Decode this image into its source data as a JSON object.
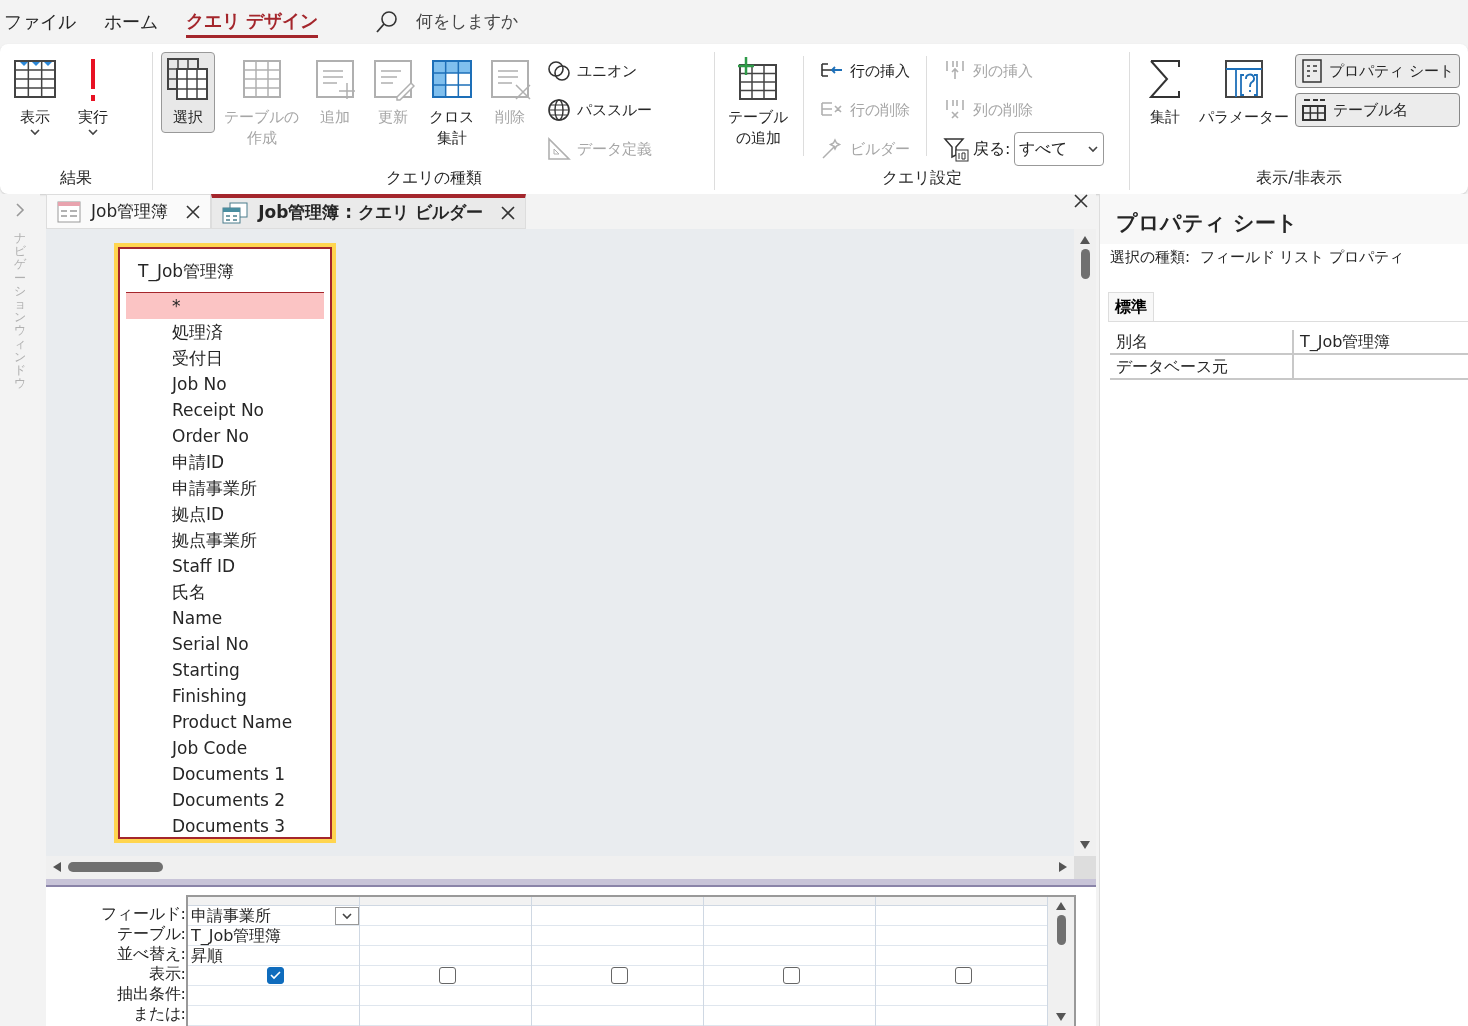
{
  "menu_tabs": [
    {
      "label": "ファイル",
      "selected": false
    },
    {
      "label": "ホーム",
      "selected": false
    },
    {
      "label": "クエリ デザイン",
      "selected": true
    }
  ],
  "tell_me": {
    "placeholder": "何をしますか"
  },
  "ribbon_groups": [
    {
      "label": "結果",
      "buttons": [
        {
          "kind": "large",
          "label": "表示",
          "dropdown": true,
          "disabled": false,
          "selected": false
        },
        {
          "kind": "large",
          "label": "実行",
          "dropdown": true,
          "disabled": false,
          "selected": false
        }
      ]
    },
    {
      "label": "クエリの種類",
      "buttons": [
        {
          "kind": "large",
          "label": "選択",
          "dropdown": false,
          "disabled": false,
          "selected": true
        },
        {
          "kind": "large",
          "label": "テーブルの作成",
          "dropdown": false,
          "disabled": true,
          "selected": false
        },
        {
          "kind": "large",
          "label": "追加",
          "dropdown": false,
          "disabled": true,
          "selected": false
        },
        {
          "kind": "large",
          "label": "更新",
          "dropdown": false,
          "disabled": true,
          "selected": false
        },
        {
          "kind": "large",
          "label": "クロス集計",
          "dropdown": false,
          "disabled": false,
          "selected": false
        },
        {
          "kind": "large",
          "label": "削除",
          "dropdown": false,
          "disabled": true,
          "selected": false
        },
        {
          "kind": "small",
          "label": "ユニオン",
          "disabled": false,
          "selected": false
        },
        {
          "kind": "small",
          "label": "パススルー",
          "disabled": false,
          "selected": false
        },
        {
          "kind": "small",
          "label": "データ定義",
          "disabled": true,
          "selected": false
        }
      ]
    },
    {
      "label": "クエリ設定",
      "buttons": [
        {
          "kind": "large",
          "label": "テーブルの追加",
          "dropdown": false,
          "disabled": false,
          "selected": false
        },
        {
          "kind": "separator"
        },
        {
          "kind": "small",
          "label": "行の挿入",
          "disabled": false,
          "selected": false
        },
        {
          "kind": "small",
          "label": "行の削除",
          "disabled": true,
          "selected": false
        },
        {
          "kind": "small",
          "label": "ビルダー",
          "disabled": true,
          "selected": false
        },
        {
          "kind": "separator"
        },
        {
          "kind": "small",
          "label": "列の挿入",
          "disabled": true,
          "selected": false
        },
        {
          "kind": "small",
          "label": "列の削除",
          "disabled": true,
          "selected": false
        },
        {
          "kind": "combo",
          "label": "戻る:",
          "value": "すべて",
          "dropdown": true
        }
      ]
    },
    {
      "label": "表示/非表示",
      "buttons": [
        {
          "kind": "large",
          "label": "集計",
          "dropdown": false,
          "disabled": false,
          "selected": false
        },
        {
          "kind": "large",
          "label": "パラメーター",
          "dropdown": false,
          "disabled": false,
          "selected": false
        },
        {
          "kind": "small",
          "label": "プロパティ シート",
          "disabled": false,
          "selected": true
        },
        {
          "kind": "small",
          "label": "テーブル名",
          "disabled": false,
          "selected": true
        }
      ]
    }
  ],
  "nav_pane": {
    "title": "ナビゲーションウィンドウ"
  },
  "doc_tabs": [
    {
      "label": "Job管理簿",
      "selected": false
    },
    {
      "label": "Job管理簿 : クエリ ビルダー",
      "selected": true
    }
  ],
  "field_list": {
    "title": "T_Job管理簿",
    "fields": [
      {
        "name": "*",
        "selected": true
      },
      {
        "name": "処理済",
        "selected": false
      },
      {
        "name": "受付日",
        "selected": false
      },
      {
        "name": "Job No",
        "selected": false
      },
      {
        "name": "Receipt No",
        "selected": false
      },
      {
        "name": "Order No",
        "selected": false
      },
      {
        "name": "申請ID",
        "selected": false
      },
      {
        "name": "申請事業所",
        "selected": false
      },
      {
        "name": "拠点ID",
        "selected": false
      },
      {
        "name": "拠点事業所",
        "selected": false
      },
      {
        "name": "Staff ID",
        "selected": false
      },
      {
        "name": "氏名",
        "selected": false
      },
      {
        "name": "Name",
        "selected": false
      },
      {
        "name": "Serial No",
        "selected": false
      },
      {
        "name": "Starting",
        "selected": false
      },
      {
        "name": "Finishing",
        "selected": false
      },
      {
        "name": "Product Name",
        "selected": false
      },
      {
        "name": "Job Code",
        "selected": false
      },
      {
        "name": "Documents 1",
        "selected": false
      },
      {
        "name": "Documents 2",
        "selected": false
      },
      {
        "name": "Documents 3",
        "selected": false
      }
    ]
  },
  "grid": {
    "row_labels": [
      "フィールド:",
      "テーブル:",
      "並べ替え:",
      "表示:",
      "抽出条件:",
      "または:"
    ],
    "columns": [
      {
        "field": "申請事業所",
        "table": "T_Job管理簿",
        "sort": "昇順",
        "show": true
      },
      {
        "show": false
      },
      {
        "show": false
      },
      {
        "show": false
      },
      {
        "show": false
      }
    ]
  },
  "property_sheet": {
    "title": "プロパティ シート",
    "selection_type": "選択の種類:  フィールド リスト プロパティ",
    "tabs": [
      {
        "label": "標準",
        "selected": true
      }
    ],
    "rows": [
      {
        "name": "別名",
        "value": "T_Job管理簿"
      },
      {
        "name": "データベース元"
      }
    ]
  }
}
